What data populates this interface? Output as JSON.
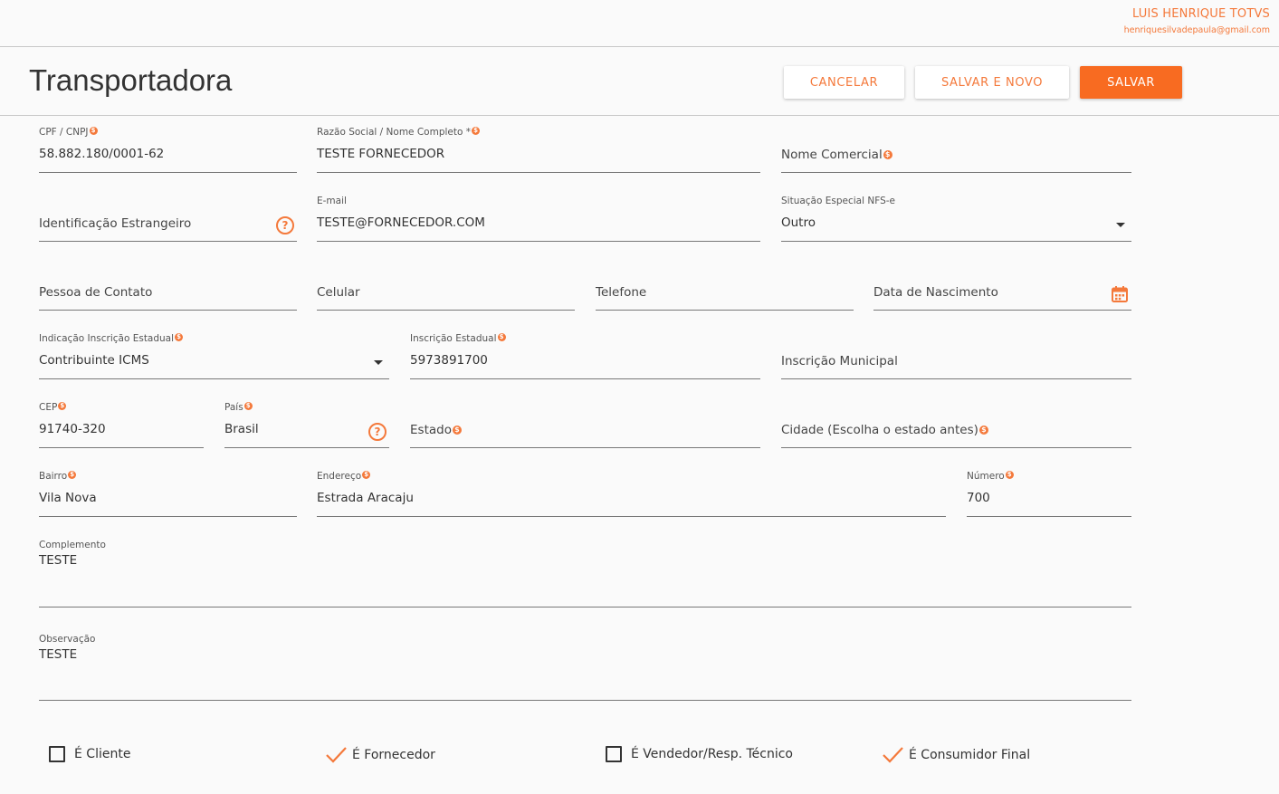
{
  "user": {
    "name": "LUIS HENRIQUE TOTVS",
    "email": "henriquesilvadepaula@gmail.com"
  },
  "page": {
    "title": "Transportadora"
  },
  "actions": {
    "cancel": "CANCELAR",
    "save_new": "SALVAR E NOVO",
    "save": "SALVAR"
  },
  "form": {
    "cpf_cnpj": {
      "label": "CPF / CNPJ",
      "value": "58.882.180/0001-62"
    },
    "razao_social": {
      "label": "Razão Social / Nome Completo *",
      "value": "TESTE FORNECEDOR"
    },
    "nome_comercial": {
      "label": "Nome Comercial"
    },
    "identificacao_estrangeiro": {
      "label": "Identificação Estrangeiro"
    },
    "email": {
      "label": "E-mail",
      "value": "TESTE@FORNECEDOR.COM"
    },
    "situacao_nfse": {
      "label": "Situação Especial NFS-e",
      "value": "Outro"
    },
    "pessoa_contato": {
      "label": "Pessoa de Contato"
    },
    "celular": {
      "label": "Celular"
    },
    "telefone": {
      "label": "Telefone"
    },
    "data_nascimento": {
      "label": "Data de Nascimento"
    },
    "indicacao_ie": {
      "label": "Indicação Inscrição Estadual",
      "value": "Contribuinte ICMS"
    },
    "inscricao_estadual": {
      "label": "Inscrição Estadual",
      "value": "5973891700"
    },
    "inscricao_municipal": {
      "label": "Inscrição Municipal"
    },
    "cep": {
      "label": "CEP",
      "value": "91740-320"
    },
    "pais": {
      "label": "País",
      "value": "Brasil"
    },
    "estado": {
      "label": "Estado"
    },
    "cidade": {
      "label": "Cidade (Escolha o estado antes)"
    },
    "bairro": {
      "label": "Bairro",
      "value": "Vila Nova"
    },
    "endereco": {
      "label": "Endereço",
      "value": "Estrada Aracaju"
    },
    "numero": {
      "label": "Número",
      "value": "700"
    },
    "complemento": {
      "label": "Complemento",
      "value": "TESTE"
    },
    "observacao": {
      "label": "Observação",
      "value": "TESTE"
    }
  },
  "checkboxes": [
    {
      "label": "É Cliente",
      "checked": false
    },
    {
      "label": "É Fornecedor",
      "checked": true
    },
    {
      "label": "É Vendedor/Resp. Técnico",
      "checked": false
    },
    {
      "label": "É Consumidor Final",
      "checked": true
    }
  ],
  "colors": {
    "accent": "#f86b21",
    "accent_text": "#f4793b"
  },
  "icons": {
    "required": "dollar-dot-icon",
    "help": "question-circle-icon",
    "calendar": "calendar-icon",
    "dropdown": "caret-down-icon",
    "checked": "checkmark-icon"
  }
}
